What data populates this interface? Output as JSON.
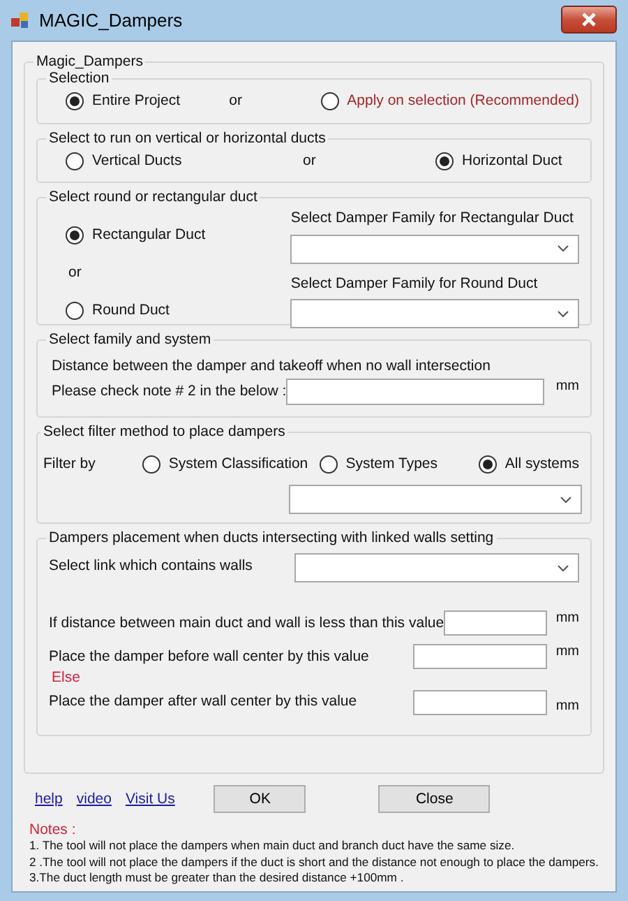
{
  "window": {
    "title": "MAGIC_Dampers"
  },
  "group_title": "Magic_Dampers",
  "selection": {
    "title": "Selection",
    "separator": "or",
    "options": [
      {
        "label": "Entire Project",
        "selected": true,
        "warning": false
      },
      {
        "label": "Apply on selection (Recommended)",
        "selected": false,
        "warning": true
      }
    ]
  },
  "orientation": {
    "title": "Select to run on vertical or horizontal ducts",
    "separator": "or",
    "options": [
      {
        "label": "Vertical Ducts",
        "selected": false
      },
      {
        "label": "Horizontal Duct",
        "selected": true
      }
    ]
  },
  "shape": {
    "title": "Select round or rectangular duct",
    "separator": "or",
    "options": [
      {
        "label": "Rectangular Duct",
        "selected": true,
        "select_label": "Select Damper Family for Rectangular Duct"
      },
      {
        "label": "Round Duct",
        "selected": false,
        "select_label": "Select Damper Family for Round Duct"
      }
    ]
  },
  "family_system": {
    "title": "Select family and system",
    "description": "Distance between the damper and takeoff when no wall intersection",
    "field_label": "Please check note # 2 in the below :",
    "unit": "mm"
  },
  "filter": {
    "title": "Select filter method to place dampers",
    "label": "Filter by",
    "options": [
      {
        "label": "System Classification",
        "selected": false
      },
      {
        "label": "System Types",
        "selected": false
      },
      {
        "label": "All systems",
        "selected": true
      }
    ]
  },
  "walls": {
    "title": "Dampers placement when ducts  intersecting with linked walls setting",
    "link_label": "Select link which contains walls",
    "rows": [
      {
        "kind": "field",
        "label": "If distance between main duct and wall is less than this value",
        "unit": "mm"
      },
      {
        "kind": "field",
        "label": "Place the damper before wall center by this value",
        "unit": "mm"
      },
      {
        "kind": "note",
        "label": "Else"
      },
      {
        "kind": "field",
        "label": "Place the damper after wall center by this value",
        "unit": "mm"
      }
    ]
  },
  "links": [
    "help",
    "video",
    "Visit Us"
  ],
  "buttons": [
    "OK",
    "Close"
  ],
  "notes": {
    "title": "Notes :",
    "lines": [
      "1. The tool will not place the dampers when main duct and branch duct have the same size.",
      "2 .The tool will not place the dampers if the duct is short and the distance not enough to place the dampers.",
      "3.The duct length must be greater than the desired distance +100mm ."
    ]
  }
}
